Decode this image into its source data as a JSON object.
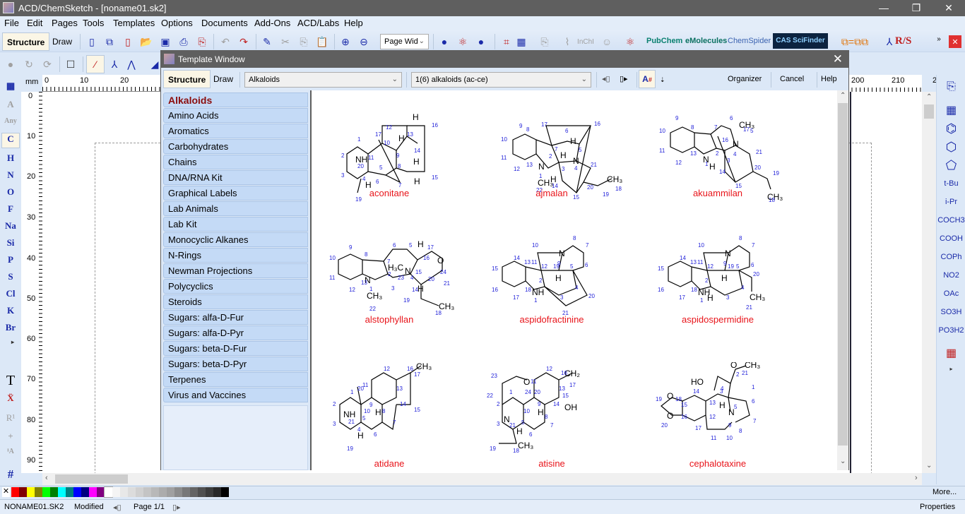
{
  "window": {
    "title": "ACD/ChemSketch - [noname01.sk2]",
    "minimize": "—",
    "restore": "❐",
    "close": "✕"
  },
  "menu": [
    "File",
    "Edit",
    "Pages",
    "Tools",
    "Templates",
    "Options",
    "Documents",
    "Add-Ons",
    "ACD/Labs",
    "Help"
  ],
  "toolbar": {
    "mode_structure": "Structure",
    "mode_draw": "Draw",
    "zoom_select": "Page Wid",
    "links": {
      "pubchem": "PubChem",
      "emolecules": "eMolecules",
      "chemspider": "ChemSpider",
      "scifinder": "CAS SciFinder",
      "rs": "R/S"
    },
    "tools": [
      "new-page-icon",
      "new-doc-icon",
      "delete-page-icon",
      "open-icon",
      "save-icon",
      "print-icon",
      "pdf-icon",
      "undo-icon",
      "redo-icon",
      "clean-icon",
      "cut-icon",
      "copy-icon",
      "paste-icon",
      "zoom-in-icon",
      "zoom-out-icon"
    ]
  },
  "ruler": {
    "unit": "mm",
    "top_left": [
      "0",
      "10",
      "20"
    ],
    "top_right": [
      "200",
      "210",
      "2"
    ],
    "left": [
      "0",
      "10",
      "20",
      "30",
      "40",
      "50",
      "60",
      "70",
      "80",
      "90"
    ]
  },
  "left_palette": {
    "elements": [
      "C",
      "H",
      "N",
      "O",
      "F",
      "Na",
      "Si",
      "P",
      "S",
      "Cl",
      "K",
      "Br"
    ],
    "extra": [
      "A",
      "Any"
    ],
    "text_tool": "T",
    "hash": "#"
  },
  "right_palette": {
    "groups": [
      "t-Bu",
      "i-Pr",
      "COCH3",
      "COOH",
      "COPh",
      "NO2",
      "OAc",
      "SO3H",
      "PO3H2"
    ]
  },
  "colors": [
    "#ff0000",
    "#800000",
    "#ffff00",
    "#808000",
    "#00ff00",
    "#008000",
    "#00ffff",
    "#008080",
    "#0000ff",
    "#000080",
    "#ff00ff",
    "#800080",
    "#ffffff",
    "#f4f4f4",
    "#e8e8e8",
    "#dcdcdc",
    "#d0d0d0",
    "#c4c4c4",
    "#b8b8b8",
    "#acacac",
    "#a0a0a0",
    "#8c8c8c",
    "#787878",
    "#646464",
    "#505050",
    "#3c3c3c",
    "#282828",
    "#000000"
  ],
  "status": {
    "file": "NONAME01.SK2",
    "state": "Modified",
    "page": "Page 1/1",
    "more": "More...",
    "properties": "Properties"
  },
  "template_window": {
    "title": "Template Window",
    "mode_structure": "Structure",
    "mode_draw": "Draw",
    "category_select": "Alkaloids",
    "page_select": "1(6) alkaloids (ac-ce)",
    "organizer": "Organizer",
    "cancel": "Cancel",
    "help": "Help",
    "categories": [
      "Alkaloids",
      "Amino Acids",
      "Aromatics",
      "Carbohydrates",
      "Chains",
      "DNA/RNA Kit",
      "Graphical Labels",
      "Lab Animals",
      "Lab Kit",
      "Monocyclic Alkanes",
      "N-Rings",
      "Newman Projections",
      "Polycyclics",
      "Steroids",
      "Sugars: alfa-D-Fur",
      "Sugars: alfa-D-Pyr",
      "Sugars: beta-D-Fur",
      "Sugars: beta-D-Pyr",
      "Terpenes",
      "Virus and Vaccines"
    ],
    "selected_category": "Alkaloids",
    "templates": [
      "aconitane",
      "ajmalan",
      "akuammilan",
      "alstophyllan",
      "aspidofractinine",
      "aspidospermidine",
      "atidane",
      "atisine",
      "cephalotaxine"
    ]
  }
}
